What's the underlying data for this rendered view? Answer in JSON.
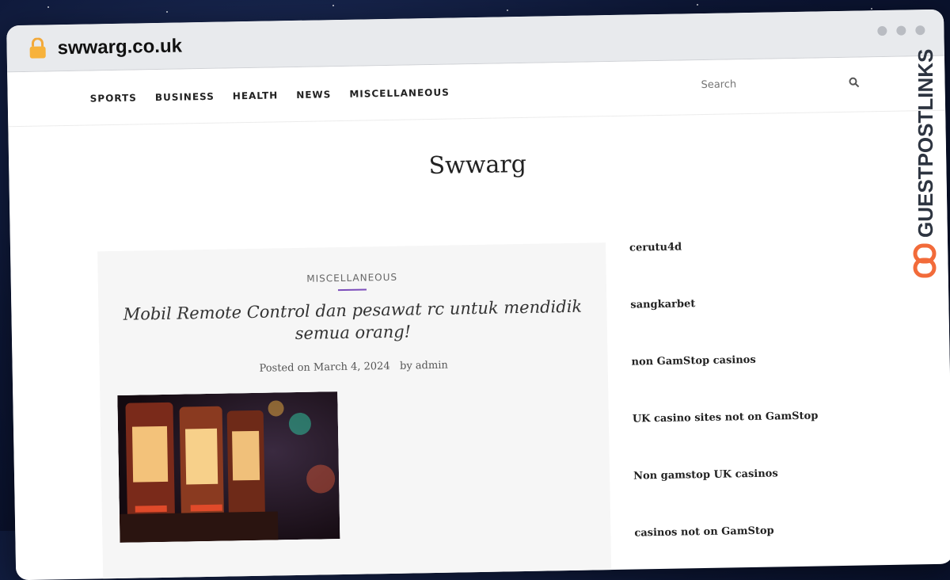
{
  "browser": {
    "url": "swwarg.co.uk"
  },
  "nav": {
    "items": [
      "SPORTS",
      "BUSINESS",
      "HEALTH",
      "NEWS",
      "MISCELLANEOUS"
    ]
  },
  "search": {
    "placeholder": "Search"
  },
  "site": {
    "title": "Swwarg"
  },
  "post": {
    "category": "MISCELLANEOUS",
    "title": "Mobil Remote Control dan pesawat rc untuk mendidik semua orang!",
    "posted_on_label": "Posted on",
    "date": "March 4, 2024",
    "by_label": "by",
    "author": "admin"
  },
  "sidebar": {
    "links": [
      "cerutu4d",
      "sangkarbet",
      "non GamStop casinos",
      "UK casino sites not on GamStop",
      "Non gamstop UK casinos",
      "casinos not on GamStop"
    ]
  },
  "badge": {
    "text": "GUESTPOSTLINKS"
  },
  "colors": {
    "accent": "#7c4dbb",
    "badge": "#2d3440",
    "badge_logo": "#f26b3a"
  }
}
